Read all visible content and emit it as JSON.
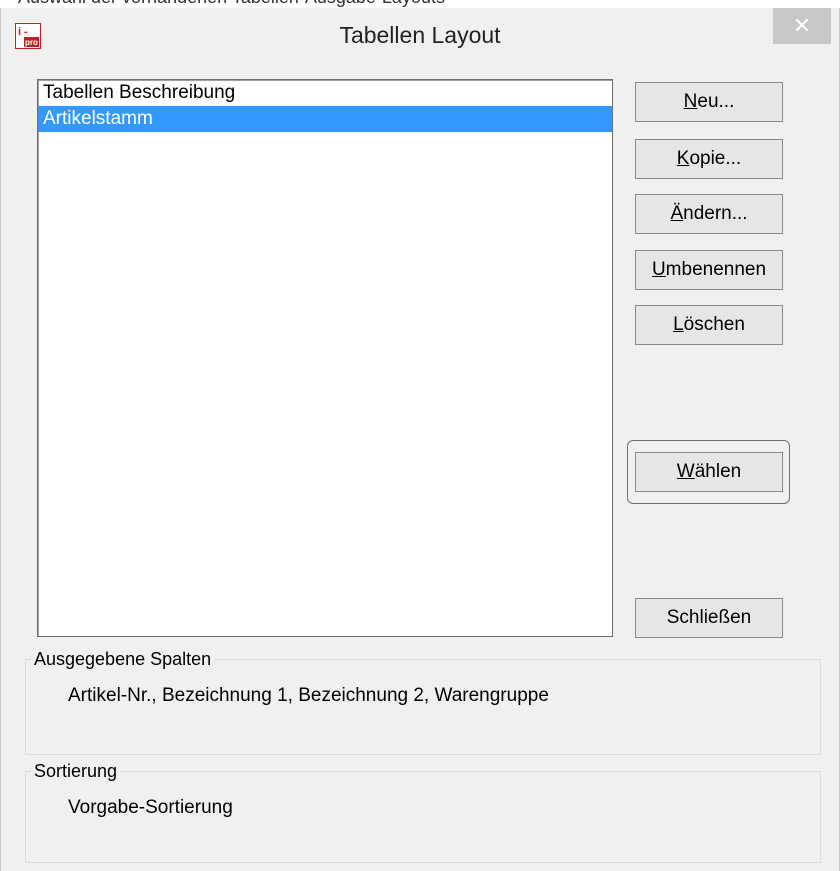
{
  "top_strip_text": "Auswahl der vorhandenen Tabellen-Ausgabe-Layouts",
  "window": {
    "title": "Tabellen Layout",
    "close_glyph": "✕",
    "app_icon": "i-pro-app-icon"
  },
  "list": {
    "items": [
      {
        "label": "Tabellen Beschreibung",
        "selected": false
      },
      {
        "label": "Artikelstamm",
        "selected": true
      }
    ]
  },
  "buttons": {
    "neu": {
      "accel": "N",
      "rest": "eu..."
    },
    "kopie": {
      "accel": "K",
      "rest": "opie..."
    },
    "aendern": {
      "accel": "Ä",
      "rest": "ndern..."
    },
    "umbenennen": {
      "accel": "U",
      "rest": "mbenennen"
    },
    "loeschen": {
      "accel": "L",
      "rest": "öschen"
    },
    "waehlen": {
      "accel": "W",
      "rest": "ählen"
    },
    "schliessen": {
      "label": "Schließen"
    }
  },
  "groups": {
    "spalten": {
      "label": "Ausgegebene Spalten",
      "value": "Artikel-Nr., Bezeichnung 1, Bezeichnung 2, Warengruppe"
    },
    "sortierung": {
      "label": "Sortierung",
      "value": "Vorgabe-Sortierung"
    }
  },
  "colors": {
    "selection": "#3399ff",
    "dialog_bg": "#f0f0f0",
    "close_bg": "#c7c7c7"
  }
}
